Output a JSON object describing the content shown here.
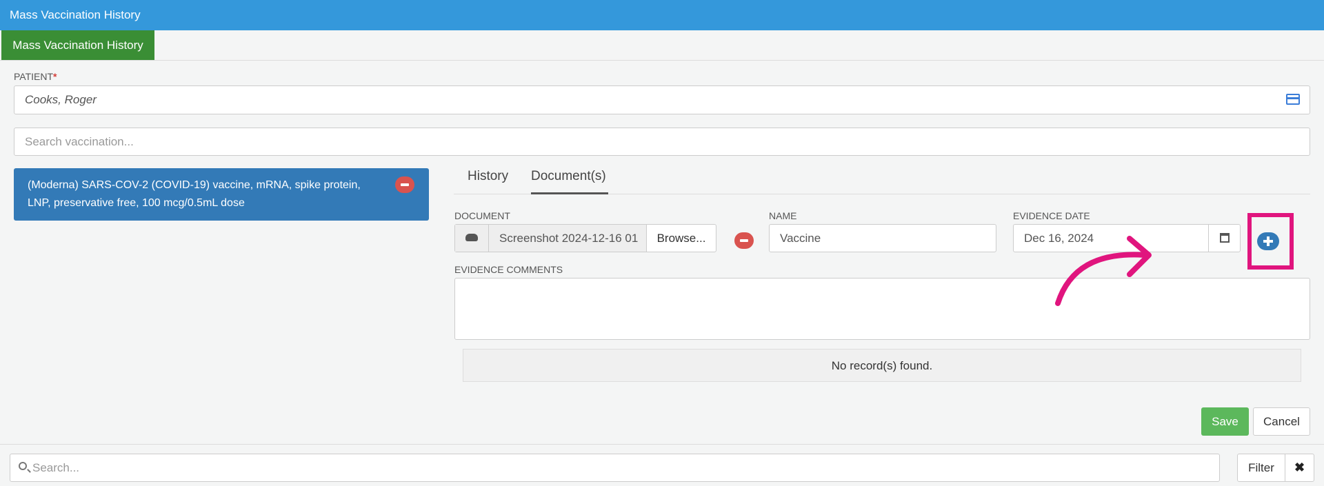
{
  "window": {
    "title": "Mass Vaccination History"
  },
  "tabs": [
    {
      "label": "Mass Vaccination History"
    }
  ],
  "patient": {
    "label": "PATIENT",
    "value": "Cooks, Roger"
  },
  "search_vaccination": {
    "placeholder": "Search vaccination..."
  },
  "vaccine_item": {
    "label": "(Moderna) SARS-COV-2 (COVID-19) vaccine, mRNA, spike protein, LNP, preservative free, 100 mcg/0.5mL dose"
  },
  "detail_tabs": {
    "history": "History",
    "documents": "Document(s)"
  },
  "document": {
    "label": "DOCUMENT",
    "file": "Screenshot 2024-12-16 01",
    "browse": "Browse..."
  },
  "name": {
    "label": "NAME",
    "value": "Vaccine"
  },
  "evidence_date": {
    "label": "EVIDENCE DATE",
    "value": "Dec 16, 2024"
  },
  "evidence_comments": {
    "label": "EVIDENCE COMMENTS"
  },
  "table": {
    "empty": "No record(s) found."
  },
  "actions": {
    "save": "Save",
    "cancel": "Cancel"
  },
  "bottom": {
    "search_placeholder": "Search...",
    "filter": "Filter",
    "clear": "✖"
  },
  "colors": {
    "header": "#3498db",
    "active_tab": "#3a8e35",
    "highlight": "#e0157e",
    "selected": "#337ab7"
  },
  "icons": [
    "card-icon",
    "minus-circle-icon",
    "plus-circle-icon",
    "cloud-upload-icon",
    "calendar-icon",
    "search-icon",
    "close-icon"
  ]
}
